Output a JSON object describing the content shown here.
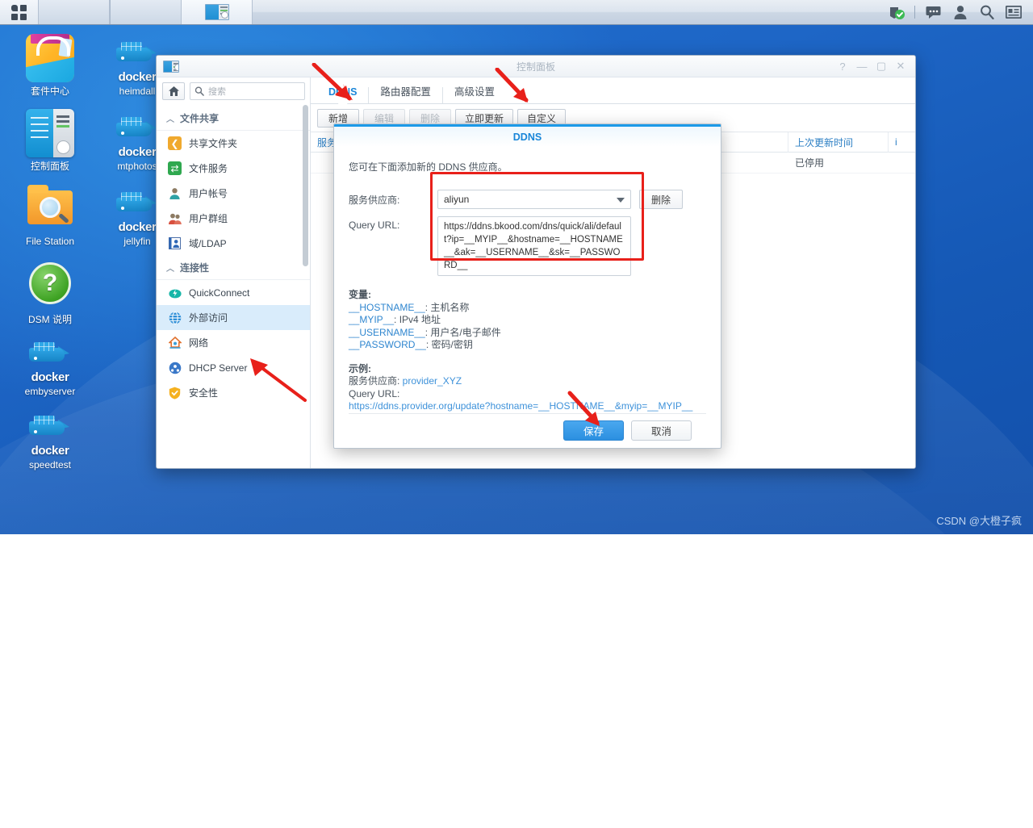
{
  "taskbar": {
    "apps_icon": "app-grid-icon",
    "items": [
      {
        "name": "empty-slot",
        "label": ""
      },
      {
        "name": "control-panel",
        "label": ""
      }
    ],
    "tray": [
      {
        "name": "notification-shield-icon",
        "glyph": "✓"
      },
      {
        "name": "chat-icon",
        "glyph": "💬"
      },
      {
        "name": "user-icon",
        "glyph": "👤"
      },
      {
        "name": "search-icon",
        "glyph": "🔍"
      },
      {
        "name": "widget-icon",
        "glyph": "▤"
      }
    ]
  },
  "desktop": {
    "icons": [
      {
        "label": "套件中心",
        "art": "package-center"
      },
      {
        "label": "控制面板",
        "art": "control-panel"
      },
      {
        "label": "File Station",
        "art": "file-station"
      },
      {
        "label": "DSM 说明",
        "art": "dsm-help"
      },
      {
        "label": "embyserver",
        "art": "docker"
      },
      {
        "label": "speedtest",
        "art": "docker"
      },
      {
        "label": "heimdall",
        "art": "docker"
      },
      {
        "label": "mtphotos",
        "art": "docker"
      },
      {
        "label": "jellyfin",
        "art": "docker"
      }
    ]
  },
  "window": {
    "title": "控制面板",
    "controls": [
      {
        "name": "help-button",
        "glyph": "?"
      },
      {
        "name": "minimize-button",
        "glyph": "—"
      },
      {
        "name": "maximize-button",
        "glyph": "▢"
      },
      {
        "name": "close-button",
        "glyph": "✕"
      }
    ]
  },
  "sidebar": {
    "home_icon": "home-icon",
    "search_placeholder": "搜索",
    "groups": [
      {
        "label": "文件共享",
        "items": [
          {
            "label": "共享文件夹",
            "icon": "shared-folder-icon",
            "color": "#f0a92e",
            "glyph": "❮"
          },
          {
            "label": "文件服务",
            "icon": "file-service-icon",
            "color": "#39b54a",
            "glyph": "⇄"
          },
          {
            "label": "用户帐号",
            "icon": "user-account-icon",
            "color": "#3aa0d8",
            "glyph": "👤"
          },
          {
            "label": "用户群组",
            "icon": "user-group-icon",
            "color": "#d94f4f",
            "glyph": "👥"
          },
          {
            "label": "域/LDAP",
            "icon": "domain-ldap-icon",
            "color": "#2f6fb5",
            "glyph": "▤"
          }
        ]
      },
      {
        "label": "连接性",
        "items": [
          {
            "label": "QuickConnect",
            "icon": "quickconnect-icon",
            "color": "#18b5a5",
            "glyph": "⚡"
          },
          {
            "label": "外部访问",
            "icon": "external-access-icon",
            "color": "#2f8fd8",
            "glyph": "🌐",
            "selected": true
          },
          {
            "label": "网络",
            "icon": "network-icon",
            "color": "#e06a2a",
            "glyph": "⌂"
          },
          {
            "label": "DHCP Server",
            "icon": "dhcp-server-icon",
            "color": "#3a78c8",
            "glyph": "●"
          },
          {
            "label": "安全性",
            "icon": "security-icon",
            "color": "#f0a92e",
            "glyph": "🛡"
          }
        ]
      }
    ]
  },
  "main": {
    "tabs": [
      {
        "label": "DDNS",
        "active": true
      },
      {
        "label": "路由器配置",
        "active": false
      },
      {
        "label": "高级设置",
        "active": false
      }
    ],
    "toolbar": [
      {
        "label": "新增",
        "disabled": false
      },
      {
        "label": "编辑",
        "disabled": true
      },
      {
        "label": "删除",
        "disabled": true
      },
      {
        "label": "立即更新",
        "disabled": false
      },
      {
        "label": "自定义",
        "disabled": false
      }
    ],
    "table": {
      "columns": [
        "服务供应商",
        "上次更新时间",
        "i"
      ],
      "rows": [
        [
          "",
          "已停用",
          ""
        ]
      ]
    }
  },
  "dialog": {
    "title": "DDNS",
    "intro": "您可在下面添加新的 DDNS 供应商。",
    "provider_label": "服务供应商:",
    "provider_value": "aliyun",
    "delete_label": "删除",
    "query_url_label": "Query URL:",
    "query_url_value": "https://ddns.bkood.com/dns/quick/ali/default?ip=__MYIP__&hostname=__HOSTNAME__&ak=__USERNAME__&sk=__PASSWORD__",
    "variables_heading": "变量:",
    "variables": [
      {
        "key": "__HOSTNAME__",
        "desc": ": 主机名称"
      },
      {
        "key": "__MYIP__",
        "desc": ": IPv4 地址"
      },
      {
        "key": "__USERNAME__",
        "desc": ": 用户名/电子邮件"
      },
      {
        "key": "__PASSWORD__",
        "desc": ": 密码/密钥"
      }
    ],
    "example_heading": "示例:",
    "example_provider_label": "服务供应商: ",
    "example_provider_value": "provider_XYZ",
    "example_url_label": "Query URL:",
    "example_url_value": "https://ddns.provider.org/update?hostname=__HOSTNAME__&myip=__MYIP__",
    "save_label": "保存",
    "cancel_label": "取消"
  },
  "annotations": {
    "highlight_color": "#e8201a",
    "arrows": [
      "ddns-tab-arrow",
      "custom-button-arrow",
      "external-access-arrow",
      "save-button-arrow"
    ]
  },
  "watermark": "CSDN @大橙子疯"
}
